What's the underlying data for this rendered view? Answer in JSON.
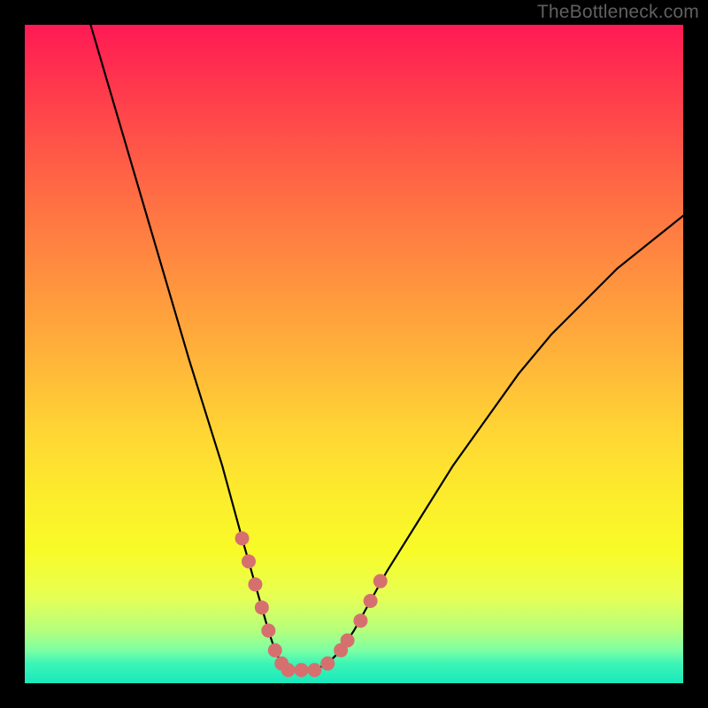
{
  "attribution": "TheBottleneck.com",
  "colors": {
    "background": "#000000",
    "curve": "#000000",
    "dots": "#d6706f",
    "gradient_top": "#ff1a55",
    "gradient_mid": "#ffd634",
    "gradient_bottom": "#1ae8bd"
  },
  "chart_data": {
    "type": "line",
    "title": "",
    "xlabel": "",
    "ylabel": "",
    "xrange": [
      0,
      100
    ],
    "yrange": [
      0,
      100
    ],
    "grid": false,
    "series": [
      {
        "name": "bottleneck-curve",
        "x": [
          10,
          15,
          20,
          25,
          30,
          33,
          35,
          37,
          38,
          39,
          40,
          42,
          44,
          46,
          48,
          50,
          55,
          60,
          65,
          70,
          75,
          80,
          85,
          90,
          95,
          100
        ],
        "values": [
          100,
          83,
          66,
          49,
          33,
          22,
          15,
          8,
          5,
          3,
          2,
          2,
          2,
          3,
          5,
          8,
          17,
          25,
          33,
          40,
          47,
          53,
          58,
          63,
          67,
          71
        ]
      }
    ],
    "markers": [
      {
        "name": "highlight-dot",
        "x": 33.0,
        "y": 22.0
      },
      {
        "name": "highlight-dot",
        "x": 34.0,
        "y": 18.5
      },
      {
        "name": "highlight-dot",
        "x": 35.0,
        "y": 15.0
      },
      {
        "name": "highlight-dot",
        "x": 36.0,
        "y": 11.5
      },
      {
        "name": "highlight-dot",
        "x": 37.0,
        "y": 8.0
      },
      {
        "name": "highlight-dot",
        "x": 38.0,
        "y": 5.0
      },
      {
        "name": "highlight-dot",
        "x": 39.0,
        "y": 3.0
      },
      {
        "name": "highlight-dot",
        "x": 40.0,
        "y": 2.0
      },
      {
        "name": "highlight-dot",
        "x": 42.0,
        "y": 2.0
      },
      {
        "name": "highlight-dot",
        "x": 44.0,
        "y": 2.0
      },
      {
        "name": "highlight-dot",
        "x": 46.0,
        "y": 3.0
      },
      {
        "name": "highlight-dot",
        "x": 48.0,
        "y": 5.0
      },
      {
        "name": "highlight-dot",
        "x": 49.0,
        "y": 6.5
      },
      {
        "name": "highlight-dot",
        "x": 51.0,
        "y": 9.5
      },
      {
        "name": "highlight-dot",
        "x": 52.5,
        "y": 12.5
      },
      {
        "name": "highlight-dot",
        "x": 54.0,
        "y": 15.5
      }
    ]
  }
}
